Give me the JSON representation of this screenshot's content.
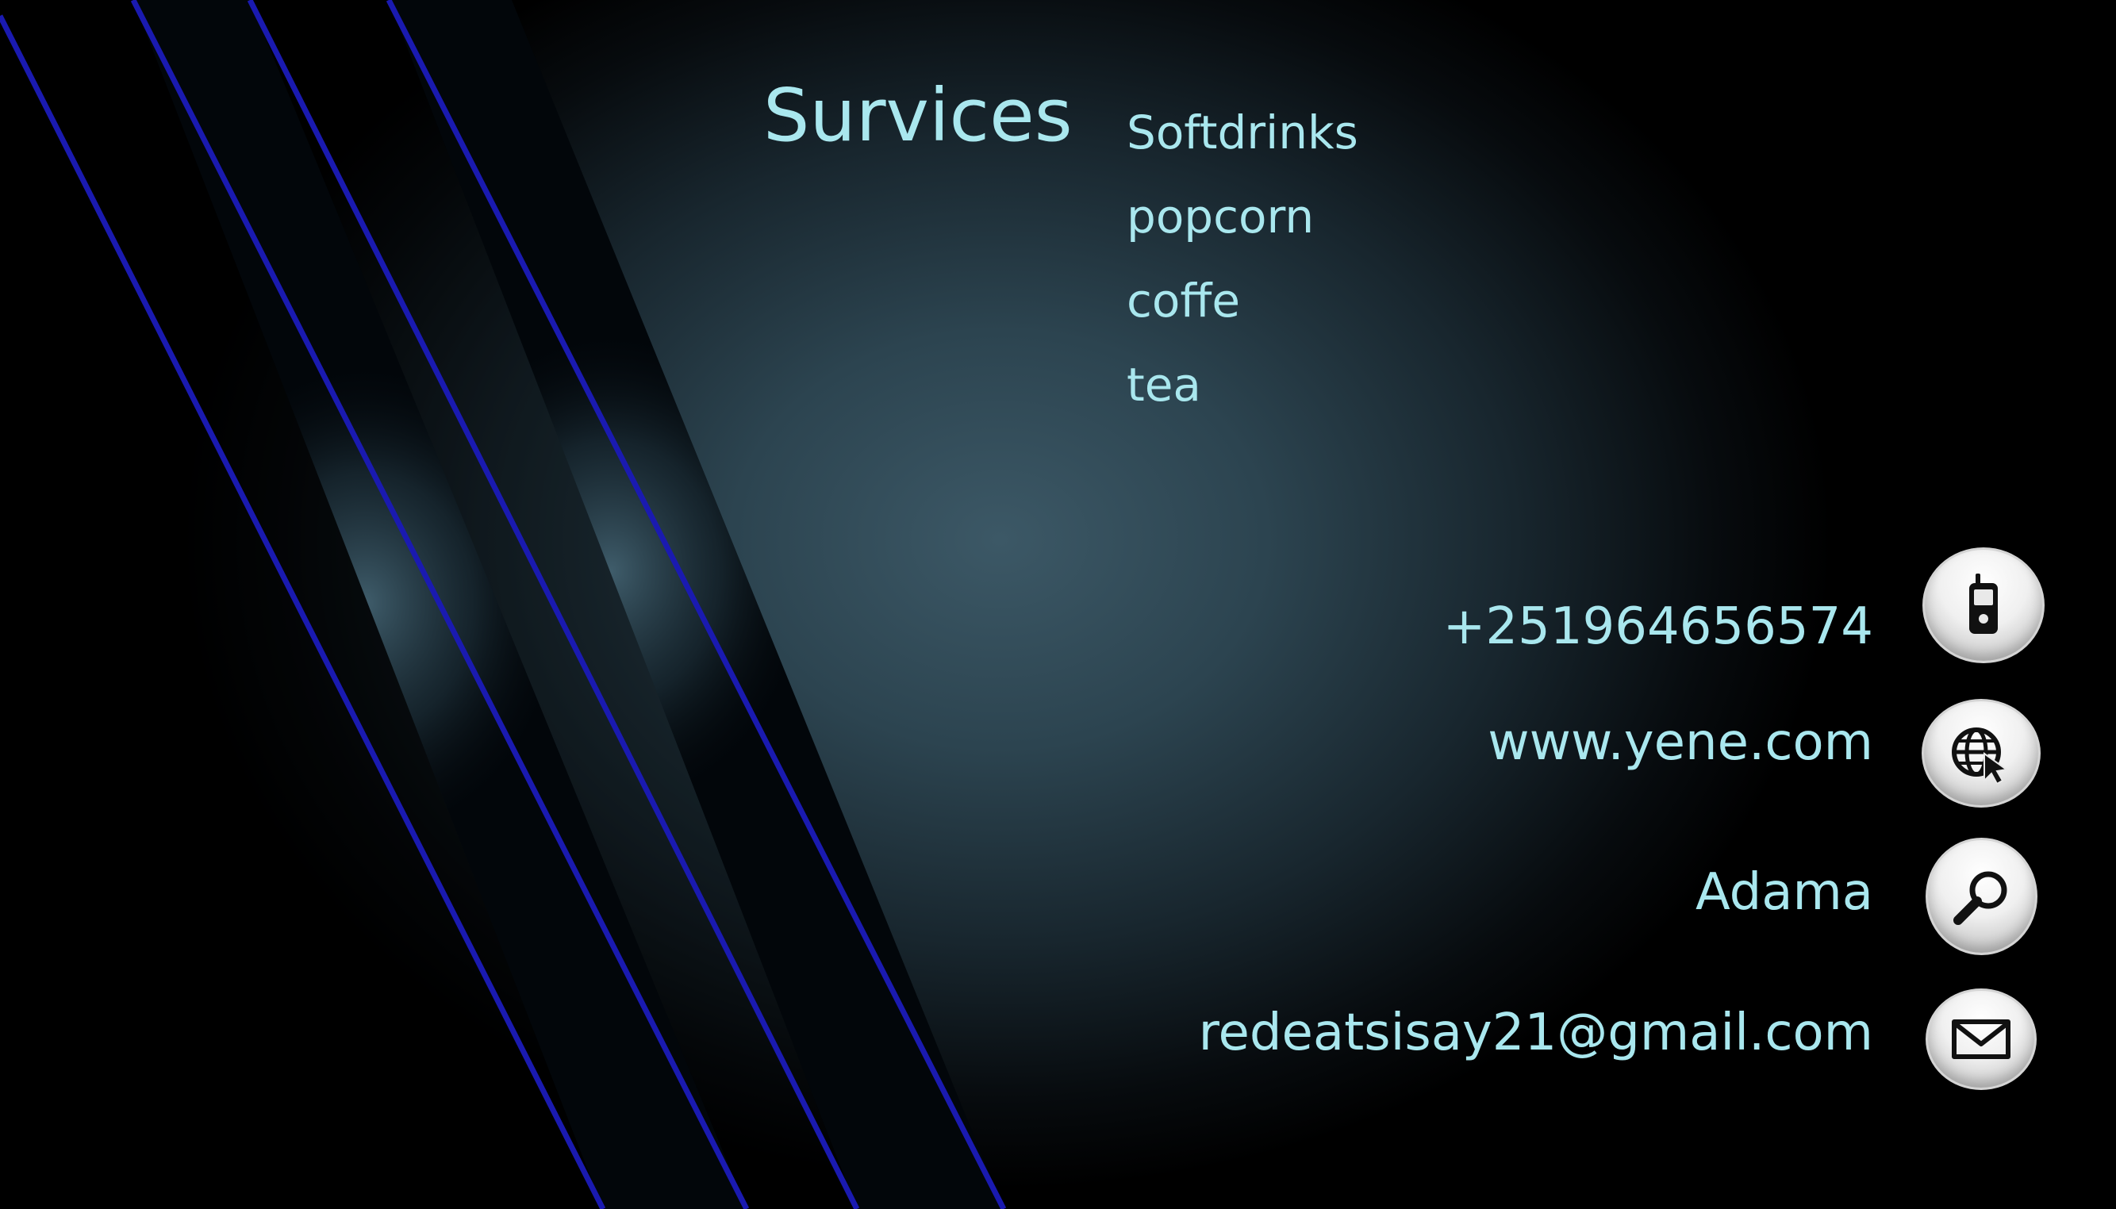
{
  "services": {
    "heading": "Survices",
    "items": [
      "Softdrinks",
      "popcorn",
      "coffe",
      "tea"
    ]
  },
  "contacts": [
    {
      "icon": "phone-icon",
      "text": "+251964656574"
    },
    {
      "icon": "globe-icon",
      "text": "www.yene.com"
    },
    {
      "icon": "magnifier-icon",
      "text": "Adama"
    },
    {
      "icon": "envelope-icon",
      "text": "redeatsisay21@gmail.com"
    }
  ],
  "colors": {
    "text": "#a9e7ee",
    "accent_stripe": "#1a1ab0",
    "background_center": "#3c5866",
    "background_edge": "#000000"
  }
}
